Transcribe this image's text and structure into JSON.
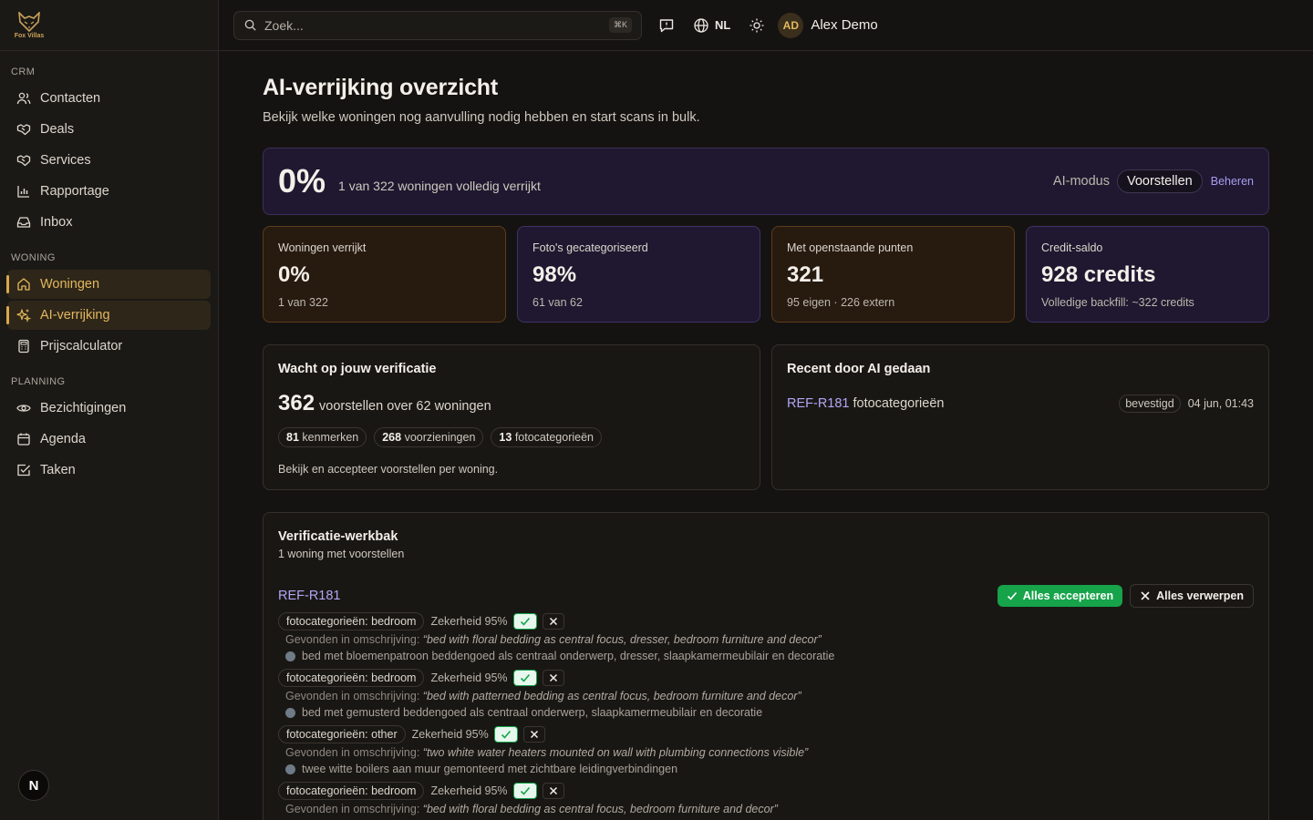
{
  "brand": {
    "name": "Fox Villas",
    "accent": "#e3b85f"
  },
  "sidebar": {
    "sections": [
      {
        "heading": "CRM",
        "items": [
          {
            "label": "Contacten",
            "icon": "users-icon"
          },
          {
            "label": "Deals",
            "icon": "handshake-icon"
          },
          {
            "label": "Services",
            "icon": "handshake-icon"
          },
          {
            "label": "Rapportage",
            "icon": "chart-icon"
          },
          {
            "label": "Inbox",
            "icon": "inbox-icon"
          }
        ]
      },
      {
        "heading": "WONING",
        "items": [
          {
            "label": "Woningen",
            "icon": "home-icon",
            "active": true
          },
          {
            "label": "AI-verrijking",
            "icon": "sparkles-icon",
            "active": true
          },
          {
            "label": "Prijscalculator",
            "icon": "calculator-icon"
          }
        ]
      },
      {
        "heading": "PLANNING",
        "items": [
          {
            "label": "Bezichtigingen",
            "icon": "eye-icon"
          },
          {
            "label": "Agenda",
            "icon": "calendar-icon"
          },
          {
            "label": "Taken",
            "icon": "checkbox-icon"
          }
        ]
      }
    ],
    "fab_label": "N"
  },
  "topbar": {
    "search_placeholder": "Zoek...",
    "shortcut": "⌘K",
    "language": "NL",
    "user_initials": "AD",
    "user_name": "Alex Demo"
  },
  "page": {
    "title": "AI-verrijking overzicht",
    "subtitle": "Bekijk welke woningen nog aanvulling nodig hebben en start scans in bulk."
  },
  "hero": {
    "percent": "0%",
    "text": "1 van 322 woningen volledig verrijkt",
    "mode_label": "AI-modus",
    "mode_value": "Voorstellen",
    "manage_label": "Beheren"
  },
  "stats": [
    {
      "label": "Woningen verrijkt",
      "value": "0%",
      "sub": "1 van 322",
      "tone": "amber"
    },
    {
      "label": "Foto's gecategoriseerd",
      "value": "98%",
      "sub": "61 van 62",
      "tone": "violet"
    },
    {
      "label": "Met openstaande punten",
      "value": "321",
      "sub": "95 eigen · 226 extern",
      "tone": "amber"
    },
    {
      "label": "Credit-saldo",
      "value": "928 credits",
      "sub": "Volledige backfill: ~322 credits",
      "tone": "violet"
    }
  ],
  "verification": {
    "title": "Wacht op jouw verificatie",
    "count": "362",
    "count_text": "voorstellen over 62 woningen",
    "chips": [
      {
        "num": "81",
        "label": "kenmerken"
      },
      {
        "num": "268",
        "label": "voorzieningen"
      },
      {
        "num": "13",
        "label": "fotocategorieën"
      }
    ],
    "footer": "Bekijk en accepteer voorstellen per woning."
  },
  "recent": {
    "title": "Recent door AI gedaan",
    "items": [
      {
        "ref": "REF-R181",
        "text": "fotocategorieën",
        "status": "bevestigd",
        "date": "04 jun, 01:43"
      }
    ]
  },
  "workbench": {
    "title": "Verificatie-werkbak",
    "subtitle": "1 woning met voorstellen",
    "ref": "REF-R181",
    "accept_all": "Alles accepteren",
    "reject_all": "Alles verwerpen",
    "found_prefix": "Gevonden in omschrijving:",
    "suggestions": [
      {
        "label": "fotocategorieën: bedroom",
        "confidence": "Zekerheid 95%",
        "quote": "“bed with floral bedding as central focus, dresser, bedroom furniture and decor”",
        "translation": "bed met bloemenpatroon beddengoed als centraal onderwerp, dresser, slaapkamermeubilair en decoratie"
      },
      {
        "label": "fotocategorieën: bedroom",
        "confidence": "Zekerheid 95%",
        "quote": "“bed with patterned bedding as central focus, bedroom furniture and decor”",
        "translation": "bed met gemusterd beddengoed als centraal onderwerp, slaapkamermeubilair en decoratie"
      },
      {
        "label": "fotocategorieën: other",
        "confidence": "Zekerheid 95%",
        "quote": "“two white water heaters mounted on wall with plumbing connections visible”",
        "translation": "twee witte boilers aan muur gemonteerd met zichtbare leidingverbindingen"
      },
      {
        "label": "fotocategorieën: bedroom",
        "confidence": "Zekerheid 95%",
        "quote": "“bed with floral bedding as central focus, bedroom furniture and decor”",
        "translation": ""
      }
    ]
  }
}
